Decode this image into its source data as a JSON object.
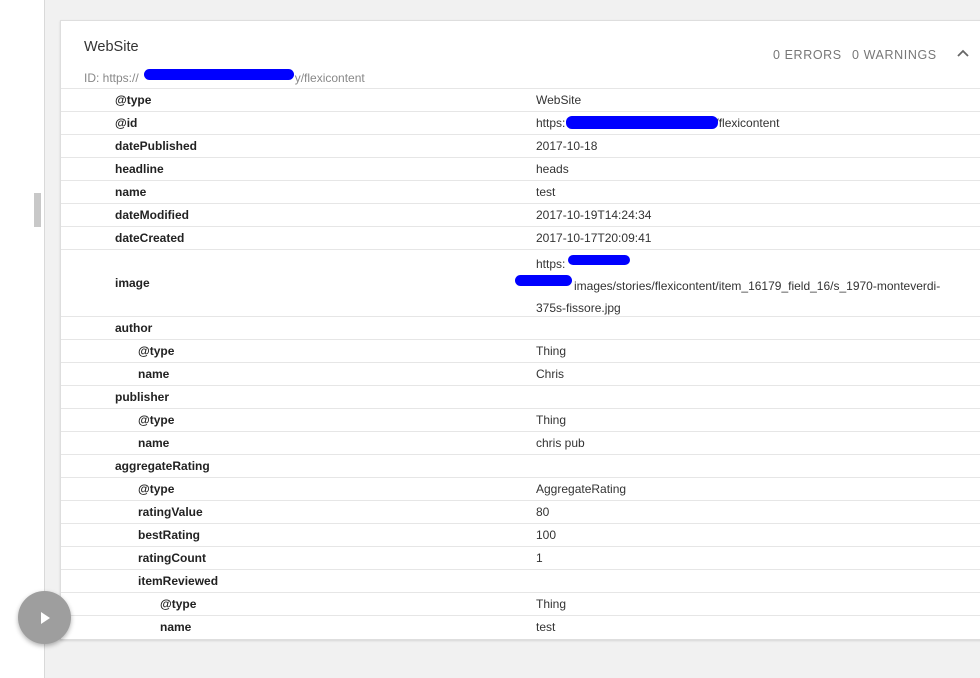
{
  "card": {
    "title": "WebSite",
    "id_prefix": "ID: https://",
    "id_suffix": "y/flexicontent",
    "errors": "0 ERRORS",
    "warnings": "0 WARNINGS",
    "collapse_icon": "chevron-up-icon"
  },
  "rows": [
    {
      "key": "@type",
      "value": "WebSite"
    },
    {
      "key": "@id",
      "value_prefix": "https:",
      "value_suffix": "/flexicontent"
    },
    {
      "key": "datePublished",
      "value": "2017-10-18"
    },
    {
      "key": "headline",
      "value": "heads"
    },
    {
      "key": "name",
      "value": "test"
    },
    {
      "key": "dateModified",
      "value": "2017-10-19T14:24:34"
    },
    {
      "key": "dateCreated",
      "value": "2017-10-17T20:09:41"
    },
    {
      "key": "image",
      "line1": "https:",
      "line2": "images/stories/flexicontent/item_16179_field_16/s_1970-monteverdi-",
      "line3": "375s-fissore.jpg"
    },
    {
      "key": "author",
      "value": ""
    },
    {
      "key": "@type",
      "value": "Thing"
    },
    {
      "key": "name",
      "value": "Chris"
    },
    {
      "key": "publisher",
      "value": ""
    },
    {
      "key": "@type",
      "value": "Thing"
    },
    {
      "key": "name",
      "value": "chris pub"
    },
    {
      "key": "aggregateRating",
      "value": ""
    },
    {
      "key": "@type",
      "value": "AggregateRating"
    },
    {
      "key": "ratingValue",
      "value": "80"
    },
    {
      "key": "bestRating",
      "value": "100"
    },
    {
      "key": "ratingCount",
      "value": "1"
    },
    {
      "key": "itemReviewed",
      "value": ""
    },
    {
      "key": "@type",
      "value": "Thing"
    },
    {
      "key": "name",
      "value": "test"
    }
  ],
  "colors": {
    "redaction": "#0000ff",
    "fab": "#9e9e9e"
  },
  "fab_icon": "play-icon"
}
